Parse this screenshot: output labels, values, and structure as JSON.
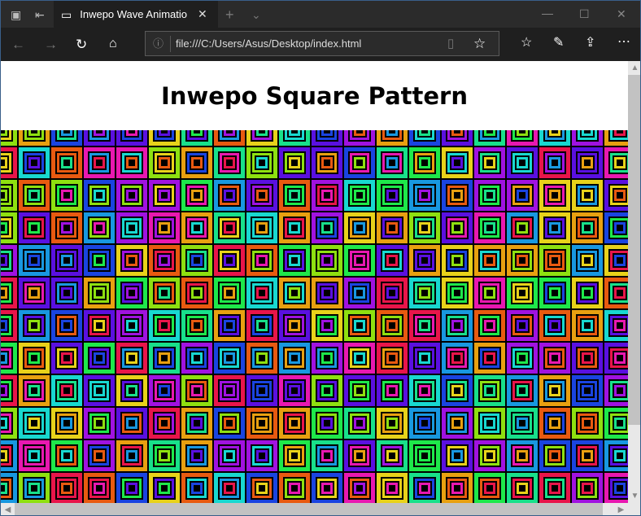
{
  "browser": {
    "tab_title": "Inwepo Wave Animatio",
    "url": "file:///C:/Users/Asus/Desktop/index.html"
  },
  "page": {
    "title": "Inwepo Square Pattern"
  },
  "pattern": {
    "palette": [
      "#e8154a",
      "#1ee84a",
      "#1a44e0",
      "#e8d21a",
      "#a012e0",
      "#18d8d0",
      "#e85a10",
      "#e818b0",
      "#8ee010",
      "#1898e0",
      "#5a10e0",
      "#18e08a",
      "#e8a010"
    ],
    "rings": 3
  }
}
